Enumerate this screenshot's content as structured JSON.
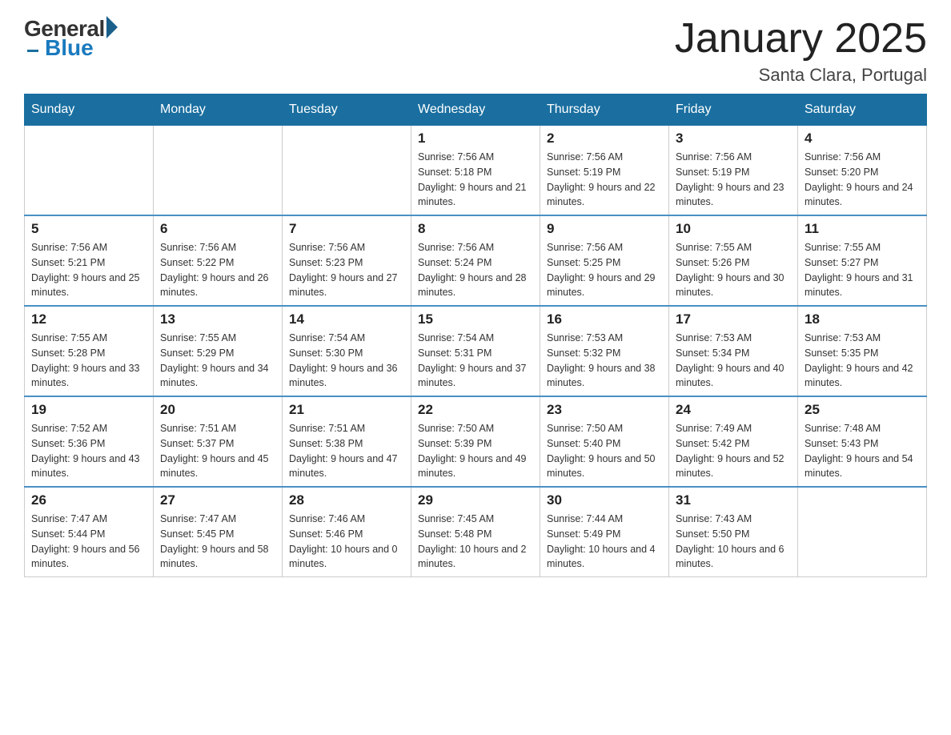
{
  "header": {
    "logo_general": "General",
    "logo_blue": "Blue",
    "title": "January 2025",
    "subtitle": "Santa Clara, Portugal"
  },
  "weekdays": [
    "Sunday",
    "Monday",
    "Tuesday",
    "Wednesday",
    "Thursday",
    "Friday",
    "Saturday"
  ],
  "weeks": [
    [
      {
        "day": "",
        "sunrise": "",
        "sunset": "",
        "daylight": ""
      },
      {
        "day": "",
        "sunrise": "",
        "sunset": "",
        "daylight": ""
      },
      {
        "day": "",
        "sunrise": "",
        "sunset": "",
        "daylight": ""
      },
      {
        "day": "1",
        "sunrise": "Sunrise: 7:56 AM",
        "sunset": "Sunset: 5:18 PM",
        "daylight": "Daylight: 9 hours and 21 minutes."
      },
      {
        "day": "2",
        "sunrise": "Sunrise: 7:56 AM",
        "sunset": "Sunset: 5:19 PM",
        "daylight": "Daylight: 9 hours and 22 minutes."
      },
      {
        "day": "3",
        "sunrise": "Sunrise: 7:56 AM",
        "sunset": "Sunset: 5:19 PM",
        "daylight": "Daylight: 9 hours and 23 minutes."
      },
      {
        "day": "4",
        "sunrise": "Sunrise: 7:56 AM",
        "sunset": "Sunset: 5:20 PM",
        "daylight": "Daylight: 9 hours and 24 minutes."
      }
    ],
    [
      {
        "day": "5",
        "sunrise": "Sunrise: 7:56 AM",
        "sunset": "Sunset: 5:21 PM",
        "daylight": "Daylight: 9 hours and 25 minutes."
      },
      {
        "day": "6",
        "sunrise": "Sunrise: 7:56 AM",
        "sunset": "Sunset: 5:22 PM",
        "daylight": "Daylight: 9 hours and 26 minutes."
      },
      {
        "day": "7",
        "sunrise": "Sunrise: 7:56 AM",
        "sunset": "Sunset: 5:23 PM",
        "daylight": "Daylight: 9 hours and 27 minutes."
      },
      {
        "day": "8",
        "sunrise": "Sunrise: 7:56 AM",
        "sunset": "Sunset: 5:24 PM",
        "daylight": "Daylight: 9 hours and 28 minutes."
      },
      {
        "day": "9",
        "sunrise": "Sunrise: 7:56 AM",
        "sunset": "Sunset: 5:25 PM",
        "daylight": "Daylight: 9 hours and 29 minutes."
      },
      {
        "day": "10",
        "sunrise": "Sunrise: 7:55 AM",
        "sunset": "Sunset: 5:26 PM",
        "daylight": "Daylight: 9 hours and 30 minutes."
      },
      {
        "day": "11",
        "sunrise": "Sunrise: 7:55 AM",
        "sunset": "Sunset: 5:27 PM",
        "daylight": "Daylight: 9 hours and 31 minutes."
      }
    ],
    [
      {
        "day": "12",
        "sunrise": "Sunrise: 7:55 AM",
        "sunset": "Sunset: 5:28 PM",
        "daylight": "Daylight: 9 hours and 33 minutes."
      },
      {
        "day": "13",
        "sunrise": "Sunrise: 7:55 AM",
        "sunset": "Sunset: 5:29 PM",
        "daylight": "Daylight: 9 hours and 34 minutes."
      },
      {
        "day": "14",
        "sunrise": "Sunrise: 7:54 AM",
        "sunset": "Sunset: 5:30 PM",
        "daylight": "Daylight: 9 hours and 36 minutes."
      },
      {
        "day": "15",
        "sunrise": "Sunrise: 7:54 AM",
        "sunset": "Sunset: 5:31 PM",
        "daylight": "Daylight: 9 hours and 37 minutes."
      },
      {
        "day": "16",
        "sunrise": "Sunrise: 7:53 AM",
        "sunset": "Sunset: 5:32 PM",
        "daylight": "Daylight: 9 hours and 38 minutes."
      },
      {
        "day": "17",
        "sunrise": "Sunrise: 7:53 AM",
        "sunset": "Sunset: 5:34 PM",
        "daylight": "Daylight: 9 hours and 40 minutes."
      },
      {
        "day": "18",
        "sunrise": "Sunrise: 7:53 AM",
        "sunset": "Sunset: 5:35 PM",
        "daylight": "Daylight: 9 hours and 42 minutes."
      }
    ],
    [
      {
        "day": "19",
        "sunrise": "Sunrise: 7:52 AM",
        "sunset": "Sunset: 5:36 PM",
        "daylight": "Daylight: 9 hours and 43 minutes."
      },
      {
        "day": "20",
        "sunrise": "Sunrise: 7:51 AM",
        "sunset": "Sunset: 5:37 PM",
        "daylight": "Daylight: 9 hours and 45 minutes."
      },
      {
        "day": "21",
        "sunrise": "Sunrise: 7:51 AM",
        "sunset": "Sunset: 5:38 PM",
        "daylight": "Daylight: 9 hours and 47 minutes."
      },
      {
        "day": "22",
        "sunrise": "Sunrise: 7:50 AM",
        "sunset": "Sunset: 5:39 PM",
        "daylight": "Daylight: 9 hours and 49 minutes."
      },
      {
        "day": "23",
        "sunrise": "Sunrise: 7:50 AM",
        "sunset": "Sunset: 5:40 PM",
        "daylight": "Daylight: 9 hours and 50 minutes."
      },
      {
        "day": "24",
        "sunrise": "Sunrise: 7:49 AM",
        "sunset": "Sunset: 5:42 PM",
        "daylight": "Daylight: 9 hours and 52 minutes."
      },
      {
        "day": "25",
        "sunrise": "Sunrise: 7:48 AM",
        "sunset": "Sunset: 5:43 PM",
        "daylight": "Daylight: 9 hours and 54 minutes."
      }
    ],
    [
      {
        "day": "26",
        "sunrise": "Sunrise: 7:47 AM",
        "sunset": "Sunset: 5:44 PM",
        "daylight": "Daylight: 9 hours and 56 minutes."
      },
      {
        "day": "27",
        "sunrise": "Sunrise: 7:47 AM",
        "sunset": "Sunset: 5:45 PM",
        "daylight": "Daylight: 9 hours and 58 minutes."
      },
      {
        "day": "28",
        "sunrise": "Sunrise: 7:46 AM",
        "sunset": "Sunset: 5:46 PM",
        "daylight": "Daylight: 10 hours and 0 minutes."
      },
      {
        "day": "29",
        "sunrise": "Sunrise: 7:45 AM",
        "sunset": "Sunset: 5:48 PM",
        "daylight": "Daylight: 10 hours and 2 minutes."
      },
      {
        "day": "30",
        "sunrise": "Sunrise: 7:44 AM",
        "sunset": "Sunset: 5:49 PM",
        "daylight": "Daylight: 10 hours and 4 minutes."
      },
      {
        "day": "31",
        "sunrise": "Sunrise: 7:43 AM",
        "sunset": "Sunset: 5:50 PM",
        "daylight": "Daylight: 10 hours and 6 minutes."
      },
      {
        "day": "",
        "sunrise": "",
        "sunset": "",
        "daylight": ""
      }
    ]
  ]
}
